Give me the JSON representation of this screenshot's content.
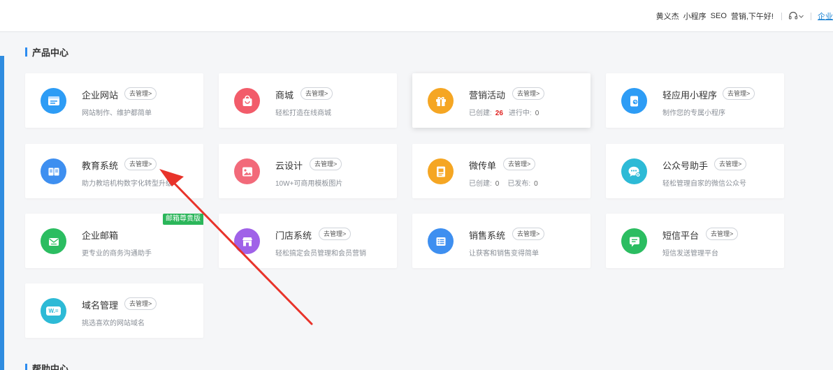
{
  "header": {
    "user": "黄义杰",
    "links": [
      "小程序",
      "SEO",
      "营销,下午好!"
    ],
    "enterprise": "企业"
  },
  "sections": {
    "products_title": "产品中心",
    "help_title": "帮助中心"
  },
  "manage_label": "去管理>",
  "cards": [
    {
      "name": "企业网站",
      "desc": "网站制作、维护都简单",
      "icon": "website-icon",
      "color": "#2d9cf5"
    },
    {
      "name": "商城",
      "desc": "轻松打造在线商城",
      "icon": "shopping-bag-icon",
      "color": "#f25c6a"
    },
    {
      "name": "营销活动",
      "created_label": "已创建:",
      "created_count": "26",
      "status_label": "进行中:",
      "status_count": "0",
      "icon": "gift-icon",
      "color": "#f5a623"
    },
    {
      "name": "轻应用小程序",
      "desc": "制作您的专属小程序",
      "icon": "mini-program-icon",
      "color": "#2d9cf5"
    },
    {
      "name": "教育系统",
      "desc": "助力教培机构数字化转型升级",
      "icon": "book-icon",
      "color": "#3e8ff0"
    },
    {
      "name": "云设计",
      "desc": "10W+可商用模板图片",
      "icon": "image-icon",
      "color": "#f26a7a"
    },
    {
      "name": "微传单",
      "created_label": "已创建:",
      "created_count": "0",
      "status_label": "已发布:",
      "status_count": "0",
      "icon": "flyer-icon",
      "color": "#f5a623"
    },
    {
      "name": "公众号助手",
      "desc": "轻松管理自家的微信公众号",
      "icon": "wechat-icon",
      "color": "#2dbad6"
    },
    {
      "name": "企业邮箱",
      "desc": "更专业的商务沟通助手",
      "badge": "邮箱尊贵版",
      "icon": "mail-icon",
      "color": "#2bbd61"
    },
    {
      "name": "门店系统",
      "desc": "轻松搞定会员管理和会员营销",
      "icon": "store-icon",
      "color": "#a062e8"
    },
    {
      "name": "销售系统",
      "desc": "让获客和销售变得简单",
      "icon": "list-icon",
      "color": "#3e8ff0"
    },
    {
      "name": "短信平台",
      "desc": "短信发送管理平台",
      "icon": "sms-icon",
      "color": "#2bbd61"
    },
    {
      "name": "域名管理",
      "desc": "挑选喜欢的网站域名",
      "icon": "domain-icon",
      "icon_text": "W.=",
      "color": "#2dbad6"
    }
  ]
}
